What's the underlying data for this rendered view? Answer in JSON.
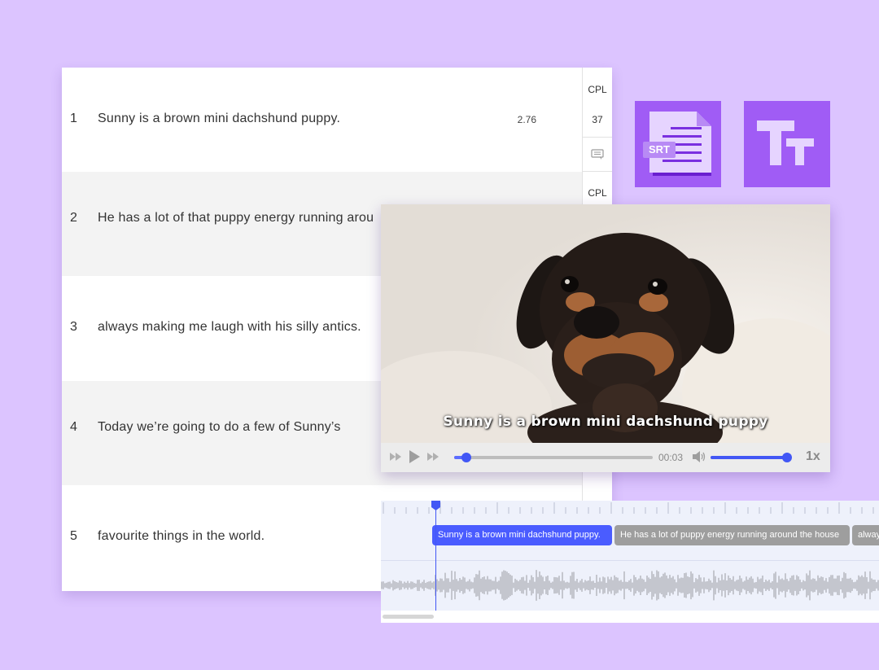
{
  "subtitle_list": {
    "rows": [
      {
        "number": "1",
        "text": "Sunny is a brown mini dachshund puppy.",
        "duration": "2.76"
      },
      {
        "number": "2",
        "text": "He has a lot of that puppy energy running arou"
      },
      {
        "number": "3",
        "text": "always making me laugh with his silly antics."
      },
      {
        "number": "4",
        "text": "Today we’re going to do a few of Sunny’s"
      },
      {
        "number": "5",
        "text": "favourite things in the world."
      }
    ],
    "side": {
      "cpl_label": "CPL",
      "cpl_value": "37",
      "cpl_label_2": "CPL"
    }
  },
  "icons": {
    "srt_label": "SRT",
    "text_tool_icon": "text-size-icon"
  },
  "player": {
    "caption": "Sunny is a brown mini dachshund puppy",
    "timecode": "00:03",
    "speed": "1x",
    "progress_percent": 6,
    "volume_percent": 100
  },
  "timeline": {
    "blocks": [
      {
        "text": "Sunny is a brown mini dachshund puppy.",
        "state": "active"
      },
      {
        "text": "He has a lot of puppy energy running around the house",
        "state": "inactive"
      },
      {
        "text": "alway",
        "state": "inactive"
      }
    ]
  },
  "colors": {
    "background": "#dcc4ff",
    "accent": "#4a5cff",
    "tile": "#a05cf5"
  }
}
